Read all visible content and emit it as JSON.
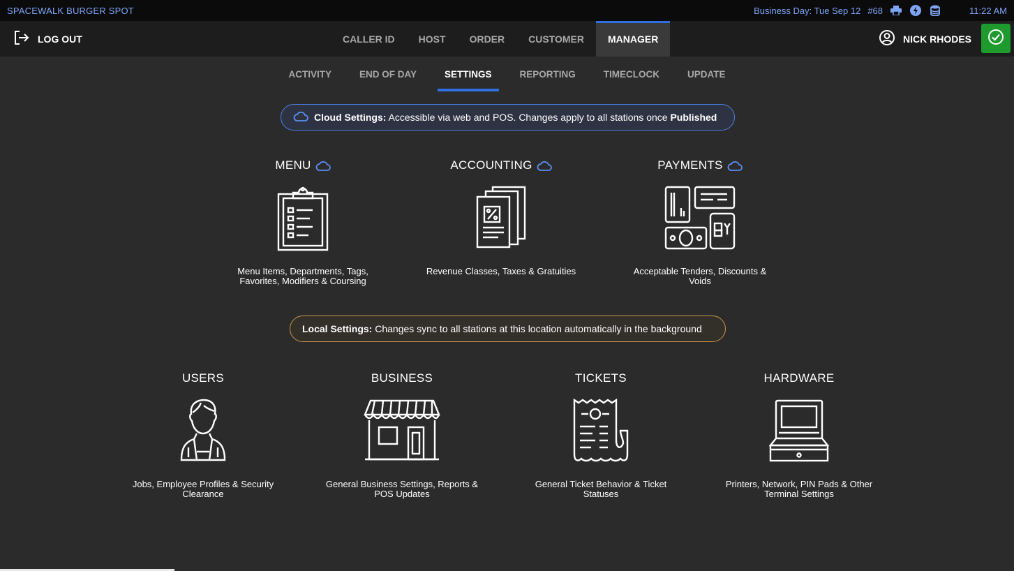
{
  "status_bar": {
    "store_name": "SPACEWALK BURGER SPOT",
    "business_day": "Business Day: Tue Sep 12",
    "station": "#68",
    "time": "11:22 AM",
    "icons": [
      "printer-icon",
      "lightning-icon",
      "database-icon"
    ]
  },
  "top_nav": {
    "logout_label": "LOG OUT",
    "tabs": [
      {
        "label": "CALLER ID",
        "active": false
      },
      {
        "label": "HOST",
        "active": false
      },
      {
        "label": "ORDER",
        "active": false
      },
      {
        "label": "CUSTOMER",
        "active": false
      },
      {
        "label": "MANAGER",
        "active": true
      }
    ],
    "user_name": "NICK RHODES"
  },
  "sub_tabs": [
    {
      "label": "ACTIVITY",
      "active": false
    },
    {
      "label": "END OF DAY",
      "active": false
    },
    {
      "label": "SETTINGS",
      "active": true
    },
    {
      "label": "REPORTING",
      "active": false
    },
    {
      "label": "TIMECLOCK",
      "active": false
    },
    {
      "label": "UPDATE",
      "active": false
    }
  ],
  "cloud_banner": {
    "bold_lead": "Cloud Settings:",
    "text": " Accessible via web and POS. Changes apply to all stations once ",
    "bold_tail": "Published"
  },
  "local_banner": {
    "bold_lead": "Local Settings:",
    "text": " Changes sync to all stations at this location automatically in the background"
  },
  "cloud_tiles": [
    {
      "title": "MENU",
      "icon": "clipboard-menu-icon",
      "desc_line1": "Menu Items, Departments, Tags,",
      "desc_line2": "Favorites, Modifiers & Coursing"
    },
    {
      "title": "ACCOUNTING",
      "icon": "tax-documents-icon",
      "desc_line1": "Revenue Classes, Taxes & Gratuities",
      "desc_line2": ""
    },
    {
      "title": "PAYMENTS",
      "icon": "payment-methods-icon",
      "desc_line1": "Acceptable Tenders, Discounts &",
      "desc_line2": "Voids"
    }
  ],
  "local_tiles": [
    {
      "title": "USERS",
      "icon": "employee-icon",
      "desc_line1": "Jobs, Employee Profiles & Security",
      "desc_line2": "Clearance"
    },
    {
      "title": "BUSINESS",
      "icon": "storefront-icon",
      "desc_line1": "General Business Settings, Reports &",
      "desc_line2": "POS Updates"
    },
    {
      "title": "TICKETS",
      "icon": "receipt-icon",
      "desc_line1": "General Ticket Behavior & Ticket",
      "desc_line2": "Statuses"
    },
    {
      "title": "HARDWARE",
      "icon": "pos-terminal-icon",
      "desc_line1": "Printers, Network, PIN Pads & Other",
      "desc_line2": "Terminal Settings"
    }
  ],
  "colors": {
    "accent_blue": "#2f6fe0",
    "status_text": "#7ea4f5",
    "confirm_green": "#1f9a2e",
    "local_border": "#c9954a"
  }
}
